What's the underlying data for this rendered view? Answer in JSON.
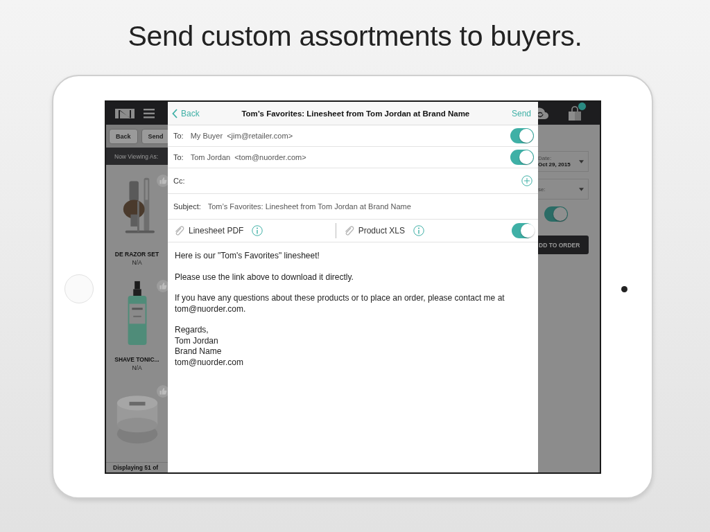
{
  "headline": "Send custom assortments to buyers.",
  "background_app": {
    "toolbar_buttons": [
      "Back",
      "Send"
    ],
    "viewing_label": "Now Viewing As:",
    "products": [
      {
        "kind": "razor",
        "name": "DE RAZOR SET",
        "price": "N/A"
      },
      {
        "kind": "bottle",
        "name": "SHAVE TONIC...",
        "price": "N/A"
      },
      {
        "kind": "jar"
      }
    ],
    "footer": "Displaying 51 of",
    "date_field": {
      "label": "Date:",
      "value": "Oct 29, 2015"
    },
    "second_field": {
      "label": "se:"
    },
    "toggle": {
      "on": true
    },
    "order_button": "DD TO ORDER"
  },
  "email": {
    "back": "Back",
    "title": "Tom’s Favorites: Linesheet from Tom Jordan at Brand Name",
    "send": "Send",
    "recipients": [
      {
        "label": "To:",
        "name": "My Buyer",
        "email": "<jim@retailer.com>",
        "on": true
      },
      {
        "label": "To:",
        "name": "Tom Jordan",
        "email": "<tom@nuorder.com>",
        "on": true
      }
    ],
    "cc_label": "Cc:",
    "subject": {
      "label": "Subject:",
      "value": "Tom’s Favorites: Linesheet from Tom Jordan at Brand Name"
    },
    "attachments": [
      {
        "name": "Linesheet PDF"
      },
      {
        "name": "Product XLS"
      }
    ],
    "attachments_on": true,
    "body": [
      {
        "lines": [
          "Here is our \"Tom's Favorites\" linesheet!"
        ]
      },
      {
        "lines": [
          "Please use the link above to download it directly."
        ]
      },
      {
        "lines": [
          "If you have any questions about these products or to place an order, please contact me at tom@nuorder.com."
        ]
      },
      {
        "lines": [
          "Regards,",
          "Tom Jordan",
          "Brand Name",
          "tom@nuorder.com"
        ]
      }
    ]
  }
}
